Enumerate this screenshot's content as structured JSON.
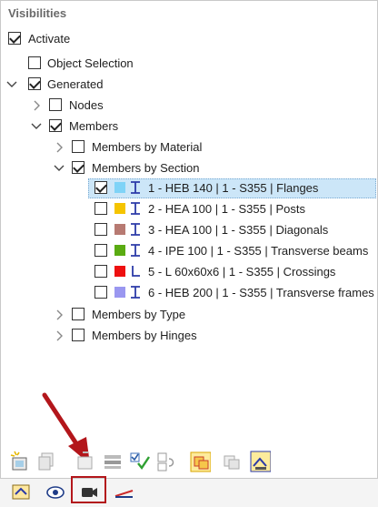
{
  "panel": {
    "title": "Visibilities"
  },
  "tree": {
    "activate": {
      "label": "Activate",
      "checked": true
    },
    "object_selection": {
      "label": "Object Selection",
      "checked": false
    },
    "generated": {
      "label": "Generated",
      "checked": true,
      "expanded": true
    },
    "nodes": {
      "label": "Nodes",
      "checked": false,
      "expanded": false
    },
    "members": {
      "label": "Members",
      "checked": true,
      "expanded": true
    },
    "members_by_material": {
      "label": "Members by Material",
      "checked": false,
      "expanded": false
    },
    "members_by_section": {
      "label": "Members by Section",
      "checked": true,
      "expanded": true
    },
    "sections": [
      {
        "label": "1 - HEB 140 | 1 - S355 | Flanges",
        "checked": true,
        "color": "#7fd3f7",
        "icon": "i-beam-icon",
        "selected": true
      },
      {
        "label": "2 - HEA 100 | 1 - S355 | Posts",
        "checked": false,
        "color": "#f5c400",
        "icon": "i-beam-icon",
        "selected": false
      },
      {
        "label": "3 - HEA 100 | 1 - S355 | Diagonals",
        "checked": false,
        "color": "#b77a72",
        "icon": "i-beam-icon",
        "selected": false
      },
      {
        "label": "4 - IPE 100 | 1 - S355 | Transverse beams",
        "checked": false,
        "color": "#5aab12",
        "icon": "i-beam-icon",
        "selected": false
      },
      {
        "label": "5 - L 60x60x6 | 1 - S355 | Crossings",
        "checked": false,
        "color": "#ee1010",
        "icon": "angle-section-icon",
        "selected": false
      },
      {
        "label": "6 - HEB 200 | 1 - S355 | Transverse frames",
        "checked": false,
        "color": "#9a97f0",
        "icon": "i-beam-icon",
        "selected": false
      }
    ],
    "members_by_type": {
      "label": "Members by Type",
      "checked": false,
      "expanded": false
    },
    "members_by_hinges": {
      "label": "Members by Hinges",
      "checked": false,
      "expanded": false
    }
  },
  "toolbar": {
    "buttons": [
      "new-visibility-icon",
      "copy-visibility-icon",
      "delete-visibility-icon",
      "edit-visibility-icon",
      "check-all-icon",
      "uncheck-all-icon",
      "show-objects-icon",
      "hide-objects-icon",
      "isolate-icon"
    ]
  },
  "tabs": [
    {
      "name": "navigator-data-tab",
      "icon": "data-icon"
    },
    {
      "name": "display-tab",
      "icon": "eye-icon"
    },
    {
      "name": "views-tab",
      "icon": "video-camera-icon",
      "highlighted": true
    },
    {
      "name": "results-tab",
      "icon": "results-line-icon"
    }
  ],
  "colors": {
    "accent_highlight": "#b3161b",
    "selection": "#cce6f8"
  }
}
